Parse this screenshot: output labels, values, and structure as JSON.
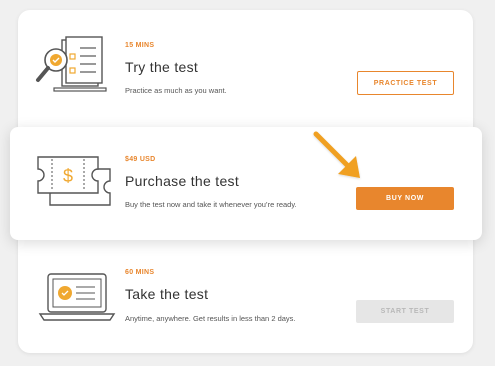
{
  "steps": [
    {
      "illustration_icon": "magnifier-document-icon",
      "pre_label": "15 MINS",
      "title": "Try the test",
      "description": "Practice as much as you want.",
      "button_label": "PRACTICE TEST",
      "button_state": "outline"
    },
    {
      "illustration_icon": "dollar-ticket-icon",
      "pre_label": "$49 USD",
      "title": "Purchase the test",
      "description": "Buy the test now and take it whenever you’re ready.",
      "button_label": "BUY NOW",
      "button_state": "solid"
    },
    {
      "illustration_icon": "laptop-test-icon",
      "pre_label": "60 MINS",
      "title": "Take the test",
      "description": "Anytime, anywhere. Get results in less than 2 days.",
      "button_label": "START TEST",
      "button_state": "disabled"
    }
  ],
  "pointer_arrow_icon": "arrow-pointer-icon",
  "colors": {
    "accent": "#e8862d",
    "disabled_bg": "#e6e6e6",
    "disabled_text": "#b8b8b8",
    "illustration_accent": "#f0a830"
  }
}
